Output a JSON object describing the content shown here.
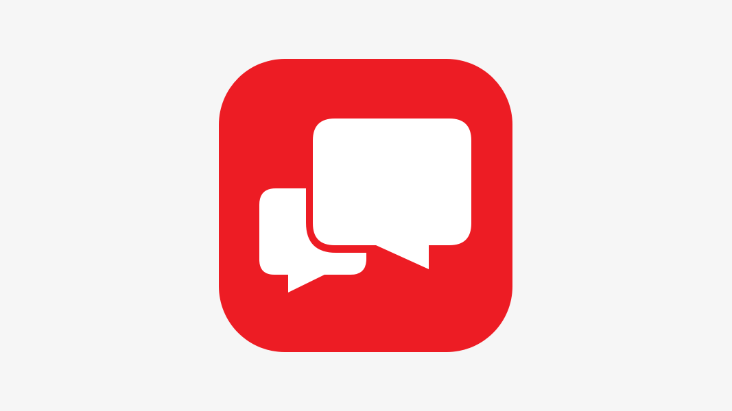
{
  "colors": {
    "background": "#f6f6f6",
    "icon_fill": "#ed1c24",
    "bubble_fill": "#ffffff"
  },
  "icon": {
    "name": "chat-bubbles-icon"
  }
}
